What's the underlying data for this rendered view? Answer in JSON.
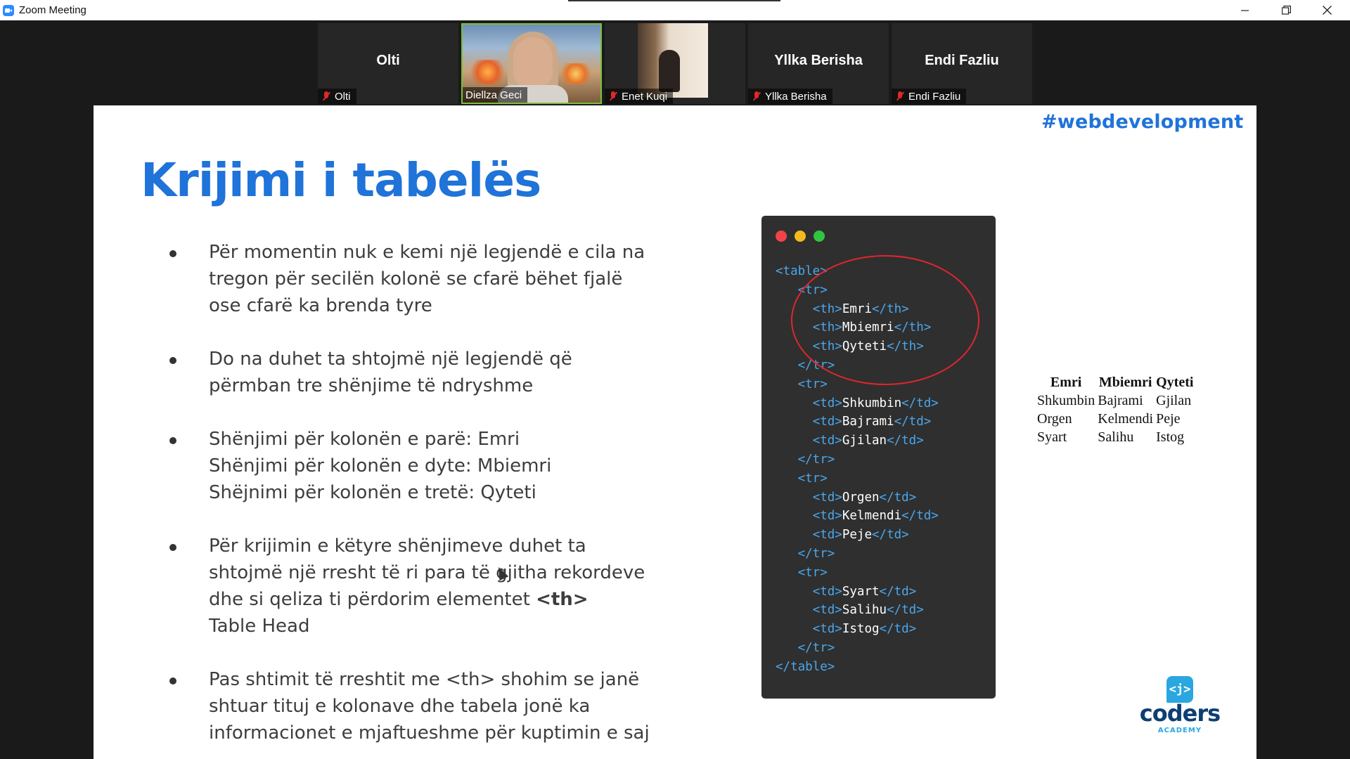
{
  "window": {
    "title": "Zoom Meeting",
    "controls": [
      "minimize-icon",
      "restore-icon",
      "close-icon"
    ]
  },
  "participants": [
    {
      "display_name": "Olti",
      "tag": "Olti",
      "muted": true,
      "video": false
    },
    {
      "display_name": "",
      "tag": "Diellza Geci",
      "muted": false,
      "video": true,
      "active_speaker": true
    },
    {
      "display_name": "",
      "tag": "Enet Kuqi",
      "muted": true,
      "video": true
    },
    {
      "display_name": "Yllka Berisha",
      "tag": "Yllka Berisha",
      "muted": true,
      "video": false
    },
    {
      "display_name": "Endi Fazliu",
      "tag": "Endi Fazliu",
      "muted": true,
      "video": false
    }
  ],
  "slide": {
    "hashtag": "#webdevelopment",
    "title": "Krijimi i tabelës",
    "bullets": [
      [
        "Për momentin nuk e kemi një legjendë e cila na",
        "tregon për secilën kolonë se cfarë bëhet fjalë",
        "ose cfarë ka brenda tyre"
      ],
      [
        "Do na duhet ta shtojmë një legjendë që",
        "përmban tre shënjime të ndryshme"
      ],
      [
        "Shënjimi për kolonën e parë: Emri",
        "Shënjimi për kolonën e dyte: Mbiemri",
        "Shëjnimi për kolonën e tretë: Qyteti"
      ],
      [
        "Për krijimin e këtyre shënjimeve duhet ta",
        "shtojmë një rresht të ri para të gjitha rekordeve",
        "dhe si qeliza ti përdorim elementet",
        "<th>",
        "Table Head"
      ],
      [
        "Pas shtimit të rreshtit me <th> shohim se janë",
        "shtuar tituj e kolonave dhe tabela jonë ka",
        "informacionet e mjaftueshme për kuptimin e saj"
      ]
    ],
    "code_lines": [
      [
        "",
        "<table>",
        ""
      ],
      [
        "   ",
        "<tr>",
        ""
      ],
      [
        "     ",
        "<th>",
        "Emri",
        "</th>"
      ],
      [
        "     ",
        "<th>",
        "Mbiemri",
        "</th>"
      ],
      [
        "     ",
        "<th>",
        "Qyteti",
        "</th>"
      ],
      [
        "   ",
        "</tr>",
        ""
      ],
      [
        "   ",
        "<tr>",
        ""
      ],
      [
        "     ",
        "<td>",
        "Shkumbin",
        "</td>"
      ],
      [
        "     ",
        "<td>",
        "Bajrami",
        "</td>"
      ],
      [
        "     ",
        "<td>",
        "Gjilan",
        "</td>"
      ],
      [
        "   ",
        "</tr>",
        ""
      ],
      [
        "   ",
        "<tr>",
        ""
      ],
      [
        "     ",
        "<td>",
        "Orgen",
        "</td>"
      ],
      [
        "     ",
        "<td>",
        "Kelmendi",
        "</td>"
      ],
      [
        "     ",
        "<td>",
        "Peje",
        "</td>"
      ],
      [
        "   ",
        "</tr>",
        ""
      ],
      [
        "   ",
        "<tr>",
        ""
      ],
      [
        "     ",
        "<td>",
        "Syart",
        "</td>"
      ],
      [
        "     ",
        "<td>",
        "Salihu",
        "</td>"
      ],
      [
        "     ",
        "<td>",
        "Istog",
        "</td>"
      ],
      [
        "   ",
        "</tr>",
        ""
      ],
      [
        "",
        "</table>",
        ""
      ]
    ],
    "table": {
      "headers": [
        "Emri",
        "Mbiemri",
        "Qyteti"
      ],
      "rows": [
        [
          "Shkumbin",
          "Bajrami",
          "Gjilan"
        ],
        [
          "Orgen",
          "Kelmendi",
          "Peje"
        ],
        [
          "Syart",
          "Salihu",
          "Istog"
        ]
      ]
    },
    "logo": {
      "mark": "<j>",
      "word": "coders",
      "sub": "ACADEMY"
    }
  },
  "colors": {
    "accent": "#1f73d9",
    "code_bg": "#2f2f2f",
    "code_tag": "#4aa6ec",
    "highlight_circle": "#e0262d",
    "active_speaker_border": "#7ebd3b",
    "muted_mic": "#e02828"
  }
}
